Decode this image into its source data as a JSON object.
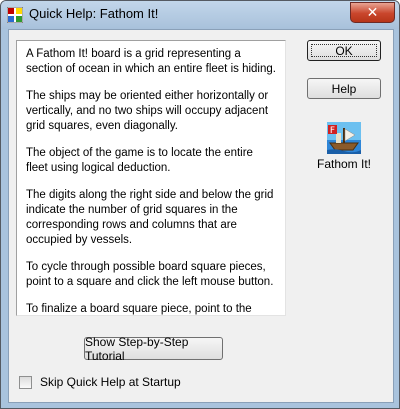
{
  "window": {
    "title": "Quick Help: Fathom It!",
    "close_glyph": "✕"
  },
  "help_paragraphs": [
    "A Fathom It! board is a grid representing a section of ocean in which an entire fleet is hiding.",
    "The ships may be oriented either horizontally or vertically, and no two ships will occupy adjacent grid squares, even diagonally.",
    "The object of the game is to locate the entire fleet using logical deduction.",
    "The digits along the right side and below the grid indicate the number of grid squares in the corresponding rows and columns that are occupied by vessels.",
    "To cycle through possible board square pieces, point to a square and click the left mouse button.",
    "To finalize a board square piece, point to the square and click the right mouse button."
  ],
  "buttons": {
    "ok": "OK",
    "help": "Help",
    "tutorial": "Show Step-by-Step Tutorial"
  },
  "game": {
    "label": "Fathom It!",
    "icon": "ship-game-icon"
  },
  "checkbox": {
    "label": "Skip Quick Help at Startup",
    "checked": false
  }
}
